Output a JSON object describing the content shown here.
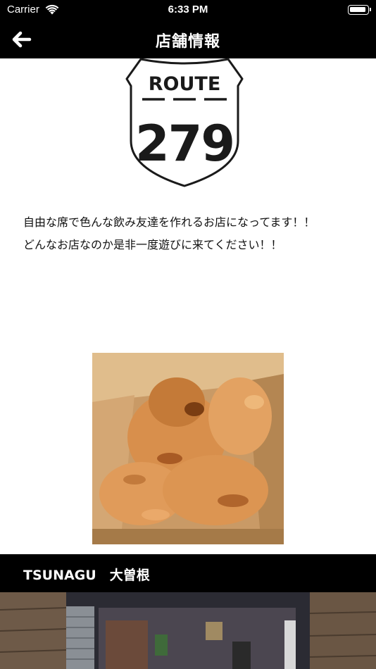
{
  "status_bar": {
    "carrier": "Carrier",
    "time": "6:33 PM"
  },
  "nav": {
    "title": "店舗情報",
    "back_icon": "arrow-left-icon"
  },
  "logo": {
    "top_text": "ROUTE",
    "number": "279"
  },
  "description": {
    "lines": [
      "自由な席で色んな飲み友達を作れるお店になってます！！",
      "どんなお店なのか是非一度遊びに来てください！！"
    ]
  },
  "photo": {
    "subject": "fried-chicken-photo"
  },
  "shop": {
    "name": "TSUNAGU　大曽根"
  },
  "colors": {
    "bar_bg": "#000000",
    "bar_text": "#ffffff",
    "body_text": "#111111"
  }
}
